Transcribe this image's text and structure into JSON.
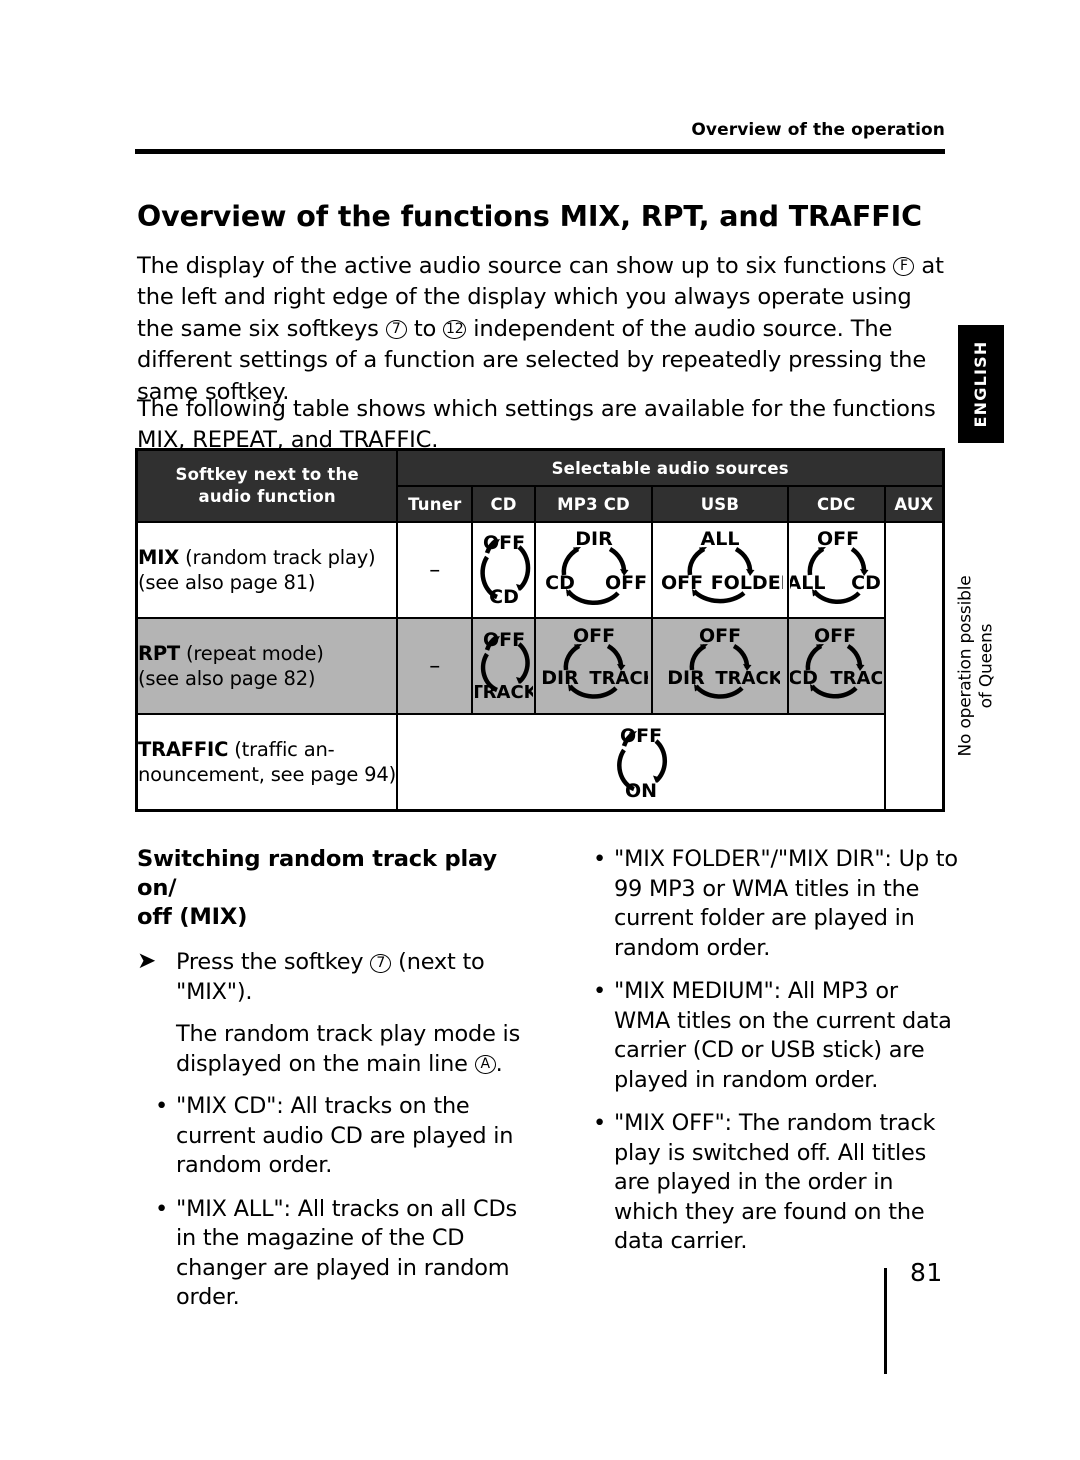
{
  "running_head": "Overview of the operation",
  "page_title": "Overview of the functions MIX, RPT, and TRAFFIC",
  "language_tab": "ENGLISH",
  "intro": {
    "p1_a": "The display of the active audio source can show up to six functions ",
    "p1_ref_f": "F",
    "p1_b": " at the left and right edge of the display which you always operate using the same six softkeys ",
    "p1_ref_7": "7",
    "p1_c": " to ",
    "p1_ref_12": "12",
    "p1_d": " independent of the audio source. The different settings of a function are selected by repeatedly pressing the same softkey.",
    "p2": "The following table shows which settings are available for the functions MIX, REPEAT, and TRAFFIC."
  },
  "table": {
    "header": {
      "softkey_col_line1": "Softkey next to the",
      "softkey_col_line2": "audio function",
      "sources_group": "Selectable audio sources",
      "sources": [
        "Tuner",
        "CD",
        "MP3 CD",
        "USB",
        "CDC",
        "AUX"
      ]
    },
    "aux_note_line1": "No operation possible",
    "aux_note_line2": "of Queens",
    "rows": [
      {
        "name": "MIX",
        "label_bold": "MIX",
        "label_rest": " (random track play)",
        "label_line2": "(see also page 81)",
        "shaded": false,
        "tuner": "–",
        "cd": {
          "type": "cycle2",
          "states": [
            "OFF",
            "CD"
          ]
        },
        "mp3cd": {
          "type": "cycle3",
          "states": [
            "DIR",
            "OFF",
            "CD"
          ]
        },
        "usb": {
          "type": "cycle3",
          "states": [
            "ALL",
            "FOLDER",
            "OFF"
          ]
        },
        "cdc": {
          "type": "cycle3",
          "states": [
            "OFF",
            "CD",
            "ALL"
          ]
        }
      },
      {
        "name": "RPT",
        "label_bold": "RPT",
        "label_rest": " (repeat mode)",
        "label_line2": "(see also page 82)",
        "shaded": true,
        "tuner": "–",
        "cd": {
          "type": "cycle2",
          "states": [
            "OFF",
            "TRACK"
          ]
        },
        "mp3cd": {
          "type": "cycle3",
          "states": [
            "OFF",
            "TRACK",
            "DIR"
          ]
        },
        "usb": {
          "type": "cycle3",
          "states": [
            "OFF",
            "TRACK",
            "DIR"
          ]
        },
        "cdc": {
          "type": "cycle3",
          "states": [
            "OFF",
            "TRACK",
            "CD"
          ]
        }
      },
      {
        "name": "TRAFFIC",
        "label_bold": "TRAFFIC",
        "label_rest": " (traffic an-",
        "label_line2": "nouncement, see page 94)",
        "shaded": false,
        "span": {
          "type": "cycle2",
          "states": [
            "OFF",
            "ON"
          ]
        }
      }
    ]
  },
  "left_column": {
    "sub_head_line1": "Switching random track play on/",
    "sub_head_line2": "off (MIX)",
    "step_a": "Press the softkey ",
    "step_ref": "7",
    "step_b": " (next to \"MIX\").",
    "result": "The random track play mode is displayed on the main line ",
    "result_ref": "A",
    "result_end": ".",
    "bullets": [
      "\"MIX CD\": All tracks on the current audio CD are played in random order.",
      "\"MIX ALL\": All tracks on all CDs in the magazine of the CD changer are played in random order."
    ]
  },
  "right_column": {
    "bullets": [
      "\"MIX FOLDER\"/\"MIX DIR\": Up to 99 MP3 or WMA titles in the current folder are played in random order.",
      "\"MIX MEDIUM\": All MP3 or WMA titles on the current data carrier (CD or USB stick) are played in random order.",
      "\"MIX OFF\": The random track play is switched off. All titles are played in the order in which they are found on the data carrier."
    ]
  },
  "footer": {
    "page_number": "81"
  },
  "colors": {
    "header_bg": "#303030",
    "shaded_row": "#b4b4b4",
    "ink": "#000000",
    "paper": "#ffffff"
  }
}
